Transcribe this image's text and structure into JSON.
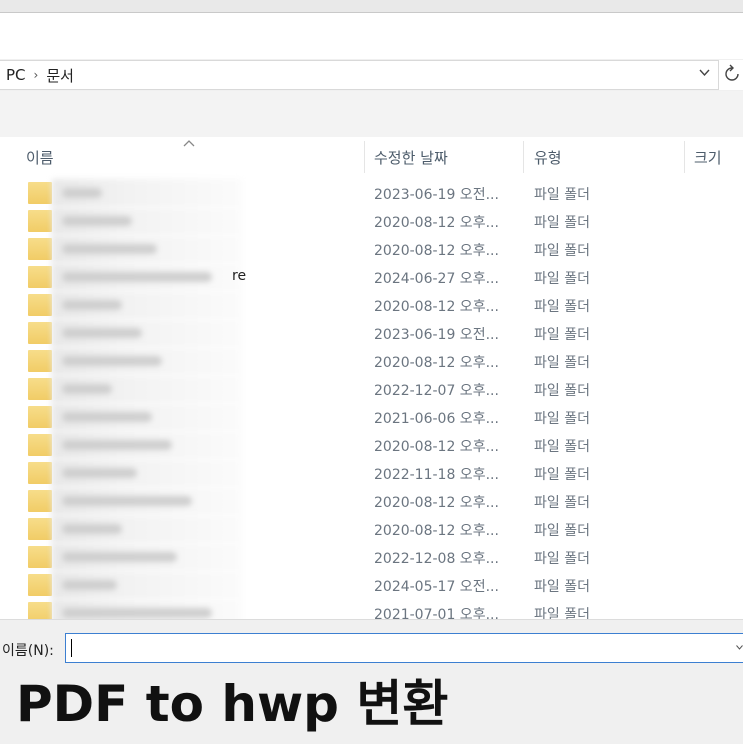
{
  "address": {
    "crumbs": [
      "PC",
      "문서"
    ],
    "separator": "›",
    "dropdown_icon": "chevron-down-icon",
    "refresh_icon": "refresh-icon"
  },
  "columns": {
    "name": "이름",
    "date": "수정한 날짜",
    "type": "유형",
    "size": "크기"
  },
  "files": [
    {
      "name": "",
      "date": "2023-06-19 오전...",
      "type": "파일 폴더"
    },
    {
      "name": "",
      "date": "2020-08-12 오후...",
      "type": "파일 폴더"
    },
    {
      "name": "",
      "date": "2020-08-12 오후...",
      "type": "파일 폴더"
    },
    {
      "name": "re",
      "date": "2024-06-27 오후...",
      "type": "파일 폴더"
    },
    {
      "name": "",
      "date": "2020-08-12 오후...",
      "type": "파일 폴더"
    },
    {
      "name": "",
      "date": "2023-06-19 오전...",
      "type": "파일 폴더"
    },
    {
      "name": "",
      "date": "2020-08-12 오후...",
      "type": "파일 폴더"
    },
    {
      "name": "",
      "date": "2022-12-07 오후...",
      "type": "파일 폴더"
    },
    {
      "name": "",
      "date": "2021-06-06 오후...",
      "type": "파일 폴더"
    },
    {
      "name": "",
      "date": "2020-08-12 오후...",
      "type": "파일 폴더"
    },
    {
      "name": "",
      "date": "2022-11-18 오후...",
      "type": "파일 폴더"
    },
    {
      "name": "",
      "date": "2020-08-12 오후...",
      "type": "파일 폴더"
    },
    {
      "name": "",
      "date": "2020-08-12 오후...",
      "type": "파일 폴더"
    },
    {
      "name": "",
      "date": "2022-12-08 오후...",
      "type": "파일 폴더"
    },
    {
      "name": "",
      "date": "2024-05-17 오전...",
      "type": "파일 폴더"
    },
    {
      "name": "",
      "date": "2021-07-01 오후...",
      "type": "파일 폴더"
    }
  ],
  "filename": {
    "label": "이름(N):",
    "value": ""
  },
  "caption": "PDF to hwp 변환"
}
